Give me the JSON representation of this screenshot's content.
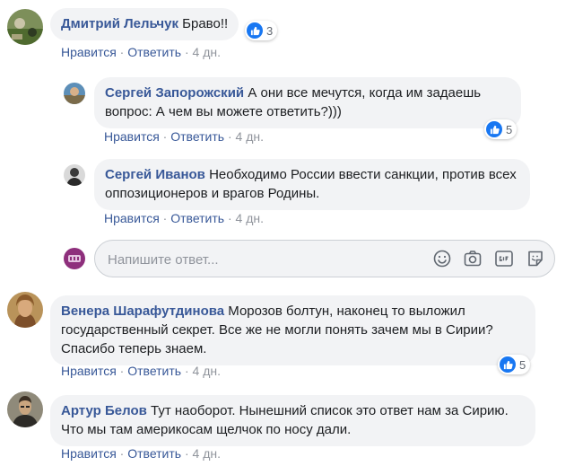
{
  "actions": {
    "like": "Нравится",
    "reply": "Ответить",
    "separator": "·"
  },
  "comments": [
    {
      "author": "Дмитрий Лельчук",
      "text": "Браво!!",
      "time": "4 дн.",
      "reactions": "3",
      "replies": [
        {
          "author": "Сергей Запорожский",
          "text": "А они все мечутся, когда им задаешь вопрос: А чем вы можете ответить?)))",
          "time": "4 дн.",
          "reactions": "5"
        },
        {
          "author": "Сергей Иванов",
          "text": "Необходимо России ввести санкции, против всех оппозиционеров и врагов Родины.",
          "time": "4 дн."
        }
      ]
    },
    {
      "author": "Венера Шарафутдинова",
      "text": "Морозов болтун, наконец то выложил государственный секрет. Все же не могли понять зачем мы в Сирии? Спасибо теперь знаем.",
      "time": "4 дн.",
      "reactions": "5"
    },
    {
      "author": "Артур Белов",
      "text": "Тут наоборот. Нынешний список это ответ нам за Сирию. Что мы там америкосам щелчок по носу дали.",
      "time": "4 дн."
    }
  ],
  "reply_box": {
    "placeholder": "Напишите ответ...",
    "icons": [
      "emoji-icon",
      "camera-icon",
      "gif-icon",
      "sticker-icon"
    ]
  },
  "colors": {
    "link": "#385898",
    "bubble": "#f2f3f5",
    "like_blue": "#1877f2",
    "meta_gray": "#90949c"
  }
}
